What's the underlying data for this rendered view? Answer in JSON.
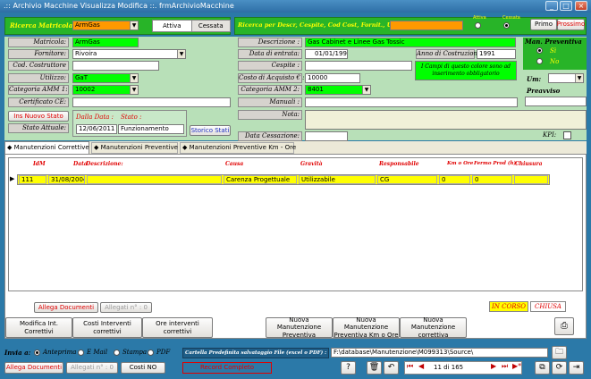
{
  "window": {
    "title": ".:: Archivio Macchine Visualizza Modifica ::.    frmArchivioMacchine",
    "min": "_",
    "max": "□",
    "close": "×"
  },
  "header": {
    "ricerca_matricola_label": "Ricerca Matricola:",
    "ricerca_matricola_value": "ArmGas",
    "attiva": "Attiva",
    "cessata": "Cessata",
    "ricerca_desc_label": "Ricerca per Descr, Cespite, Cod Cost, Fornit., Utiliz.",
    "filter_label_1": "Attiva",
    "filter_label_2": "Cessata",
    "primo": "Primo",
    "prossimo": "Prossimo"
  },
  "left": {
    "matricola_label": "Matricola:",
    "matricola_value": "ArmGas",
    "fornitore_label": "Fornitore:",
    "fornitore_value": "Rivoira",
    "cod_costruttore_label": "Cod. Costruttore",
    "cod_costruttore_value": "",
    "utilizzo_label": "Utilizzo:",
    "utilizzo_value": "GaT",
    "categoria_amm1_label": "Categoria AMM 1:",
    "categoria_amm1_value": "10002",
    "certificato_label": "Certificato CE:",
    "certificato_value": "",
    "ins_nuovo_stato": "Ins Nuovo Stato",
    "stato_attuale_label": "Stato Attuale:",
    "dalla_data_label": "Dalla Data :",
    "stato_label": "Stato :",
    "dalla_data_value": "12/06/2011",
    "stato_value": "Funzionamento",
    "storico_stati": "Storico Stati"
  },
  "right": {
    "descrizione_label": "Descrizione :",
    "descrizione_value": "Gas Cabinet e Linee Gas Tossic",
    "data_entrata_label": "Data di entrata:",
    "data_entrata_value": "01/01/1991",
    "anno_costruzione_label": "Anno di Costruzione:",
    "anno_costruzione_value": "1991",
    "cespite_label": "Cespite :",
    "cespite_value": "",
    "note_verde": "I Campi di questo colore sono ad inserimento obbligatorio",
    "costo_label": "Costo di Acquisto € :",
    "costo_value": "10000",
    "categoria_amm2_label": "Categoria AMM 2:",
    "categoria_amm2_value": "8401",
    "manuali_label": "Manuali :",
    "manuali_value": "",
    "nota_label": "Nota:",
    "nota_value": "",
    "data_cessazione_label": "Data Cessazione:",
    "data_cessazione_value": "",
    "kpi_label": "KPI:"
  },
  "preventiva": {
    "title": "Man. Preventiva",
    "si": "Sì",
    "no": "No",
    "um_label": "Um:",
    "preavviso_label": "Preavviso"
  },
  "tabs": [
    {
      "label": "Manutenzioni Correttive"
    },
    {
      "label": "Manutenzioni Preventive"
    },
    {
      "label": "Manutenzioni Preventive Km - Ore"
    }
  ],
  "grid": {
    "columns": [
      "IdM",
      "Data",
      "Descrizione:",
      "Causa",
      "Gravità",
      "Responsabile",
      "Km o Ore",
      "Fermo Prod (h) :",
      "Chiusura"
    ],
    "rows": [
      [
        "111",
        "31/08/2004",
        "",
        "Carenza Progettuale",
        "Utilizzabile",
        "CG",
        "0",
        "0",
        ""
      ]
    ]
  },
  "bottom_row": {
    "allega_documenti": "Allega Documenti",
    "allegati": "Allegati n° : 0",
    "in_corso": "IN CORSO",
    "chiusa": "CHIUSA"
  },
  "actions": {
    "modifica": "Modifica Int. Correttivi",
    "costi_interventi": "Costi Interventi correttivi",
    "ore_interventi": "Ore interventi correttivi",
    "nuova_preventiva": "Nuova Manutenzione Preventiva",
    "nuova_preventiva_km": "Nuova Manutenzione Preventiva Km o Ore",
    "nuova_correttiva": "Nuova Manutenzione correttiva"
  },
  "footer": {
    "invia_a": "Invia a:",
    "anteprima": "Anteprima",
    "email": "E Mail",
    "stampa": "Stampa",
    "pdf": "PDF",
    "cartella_label": "Cartella Predefinita salvataggio File (excel o PDF) :",
    "cartella_value": "F:\\database\\Manutenzione\\M099313\\Source\\",
    "allega_documenti": "Allega Documenti",
    "allegati": "Allegati n° : 0",
    "costi_no": "Costi NO",
    "record_status": "Record Completo",
    "nav_record": "11 di 165"
  },
  "colors": {
    "window_bg": "#2b79a8",
    "required": "#00ff00",
    "highlight": "#ffff00",
    "search": "#ff9900"
  }
}
